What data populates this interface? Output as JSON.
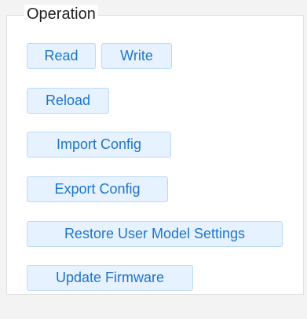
{
  "operation": {
    "title": "Operation",
    "buttons": {
      "read": "Read",
      "write": "Write",
      "reload": "Reload",
      "import_config": "Import Config",
      "export_config": "Export Config",
      "restore_user_model_settings": "Restore User Model Settings",
      "update_firmware": "Update Firmware"
    }
  },
  "colors": {
    "button_bg": "#e6f2ff",
    "button_border": "#bcd9f7",
    "button_text": "#1f74c9"
  }
}
